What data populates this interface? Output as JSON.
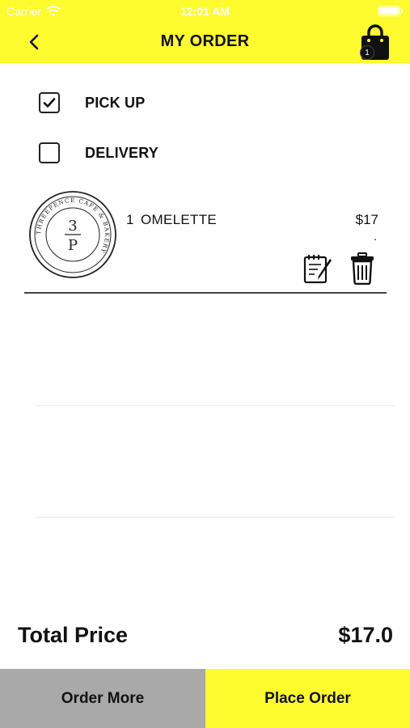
{
  "status_bar": {
    "carrier": "Carrier",
    "time": "12:01 AM"
  },
  "header": {
    "title": "MY ORDER",
    "cart_count": "1",
    "back_icon": "chevron-left-icon",
    "cart_icon": "shopping-bag-icon"
  },
  "options": [
    {
      "label": "PICK UP",
      "checked": true
    },
    {
      "label": "DELIVERY",
      "checked": false
    }
  ],
  "order_items": [
    {
      "quantity": "1",
      "name": "OMELETTE",
      "price": "$17",
      "logo": {
        "center_top": "3",
        "center_bottom": "P",
        "ring_text": "THREEPENCE CAFE & BAKERY"
      }
    }
  ],
  "total": {
    "label": "Total Price",
    "value": "$17.0"
  },
  "actions": {
    "order_more": "Order More",
    "place_order": "Place Order"
  },
  "colors": {
    "accent_yellow": "#fdfb2e",
    "secondary_gray": "#a9a9a9"
  }
}
